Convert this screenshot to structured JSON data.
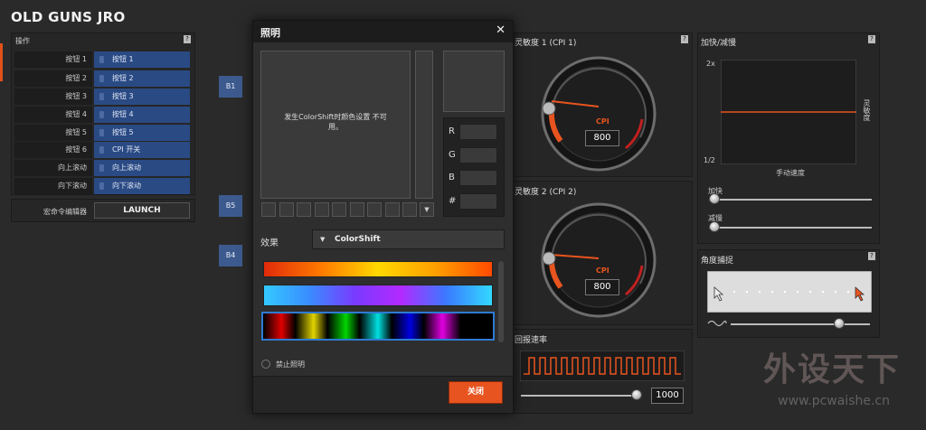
{
  "app_title": "OLD GUNS JRO",
  "mapping": {
    "header": "操作",
    "rows": [
      {
        "button": "按钮 1",
        "action": "按钮 1"
      },
      {
        "button": "按钮 2",
        "action": "按钮 2"
      },
      {
        "button": "按钮 3",
        "action": "按钮 3"
      },
      {
        "button": "按钮 4",
        "action": "按钮 4"
      },
      {
        "button": "按钮 5",
        "action": "按钮 5"
      },
      {
        "button": "按钮 6",
        "action": "CPI 开关"
      },
      {
        "button": "向上滚动",
        "action": "向上滚动"
      },
      {
        "button": "向下滚动",
        "action": "向下滚动"
      }
    ],
    "macro_label": "宏命令编辑器",
    "launch_label": "LAUNCH"
  },
  "side_chips": [
    "B1",
    "B5",
    "B4"
  ],
  "help_mark": "?",
  "lighting_dialog": {
    "title": "照明",
    "close_icon": "✕",
    "unavailable_msg": "发生ColorShift时颜色设置 不可用。",
    "rgb_labels": [
      "R",
      "G",
      "B",
      "#"
    ],
    "effect_label": "效果",
    "effect_value": "ColorShift",
    "disable_label": "禁止照明",
    "close_button": "关闭"
  },
  "sensitivity": [
    {
      "title": "灵敏度 1 (CPI 1)",
      "cpi_label": "CPI",
      "value": "800"
    },
    {
      "title": "灵敏度 2 (CPI 2)",
      "cpi_label": "CPI",
      "value": "800"
    }
  ],
  "polling": {
    "title": "回报速率",
    "value": "1000",
    "level": 1.0
  },
  "accel": {
    "title": "加快/减慢",
    "y_top": "2x",
    "y_bottom": "1/2",
    "x_label": "手动速度",
    "y_label": "灵敏度",
    "accel_label": "加快",
    "decel_label": "减慢"
  },
  "angle": {
    "title": "角度捕捉"
  },
  "watermark": {
    "text": "外设天下",
    "url": "www.pcwaishe.cn"
  },
  "colors": {
    "accent": "#e8541f",
    "mapping_blue": "#2a4a84"
  }
}
